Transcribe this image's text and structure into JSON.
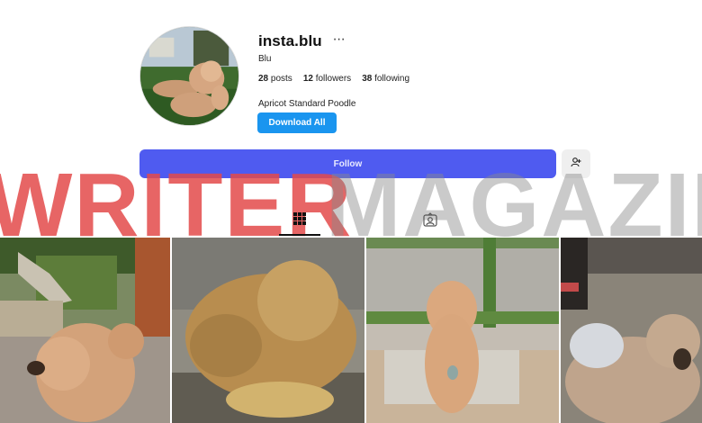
{
  "profile": {
    "username": "insta.blu",
    "more_icon": "⋯",
    "display_name": "Blu",
    "stats": {
      "posts_count": "28",
      "posts_label": "posts",
      "followers_count": "12",
      "followers_label": "followers",
      "following_count": "38",
      "following_label": "following"
    },
    "bio": "Apricot Standard Poodle",
    "download_label": "Download All",
    "follow_label": "Follow"
  },
  "icons": {
    "more": "more-options-icon",
    "suggest": "add-person-icon",
    "posts_tab": "grid-icon",
    "tagged_tab": "tagged-person-icon"
  },
  "colors": {
    "follow_button": "#4f5bf0",
    "download_button": "#1a95ef",
    "watermark_red": "#e34a4a",
    "watermark_gray": "#8a8a8a"
  },
  "watermark_text": "WRITER MAGAZINE"
}
